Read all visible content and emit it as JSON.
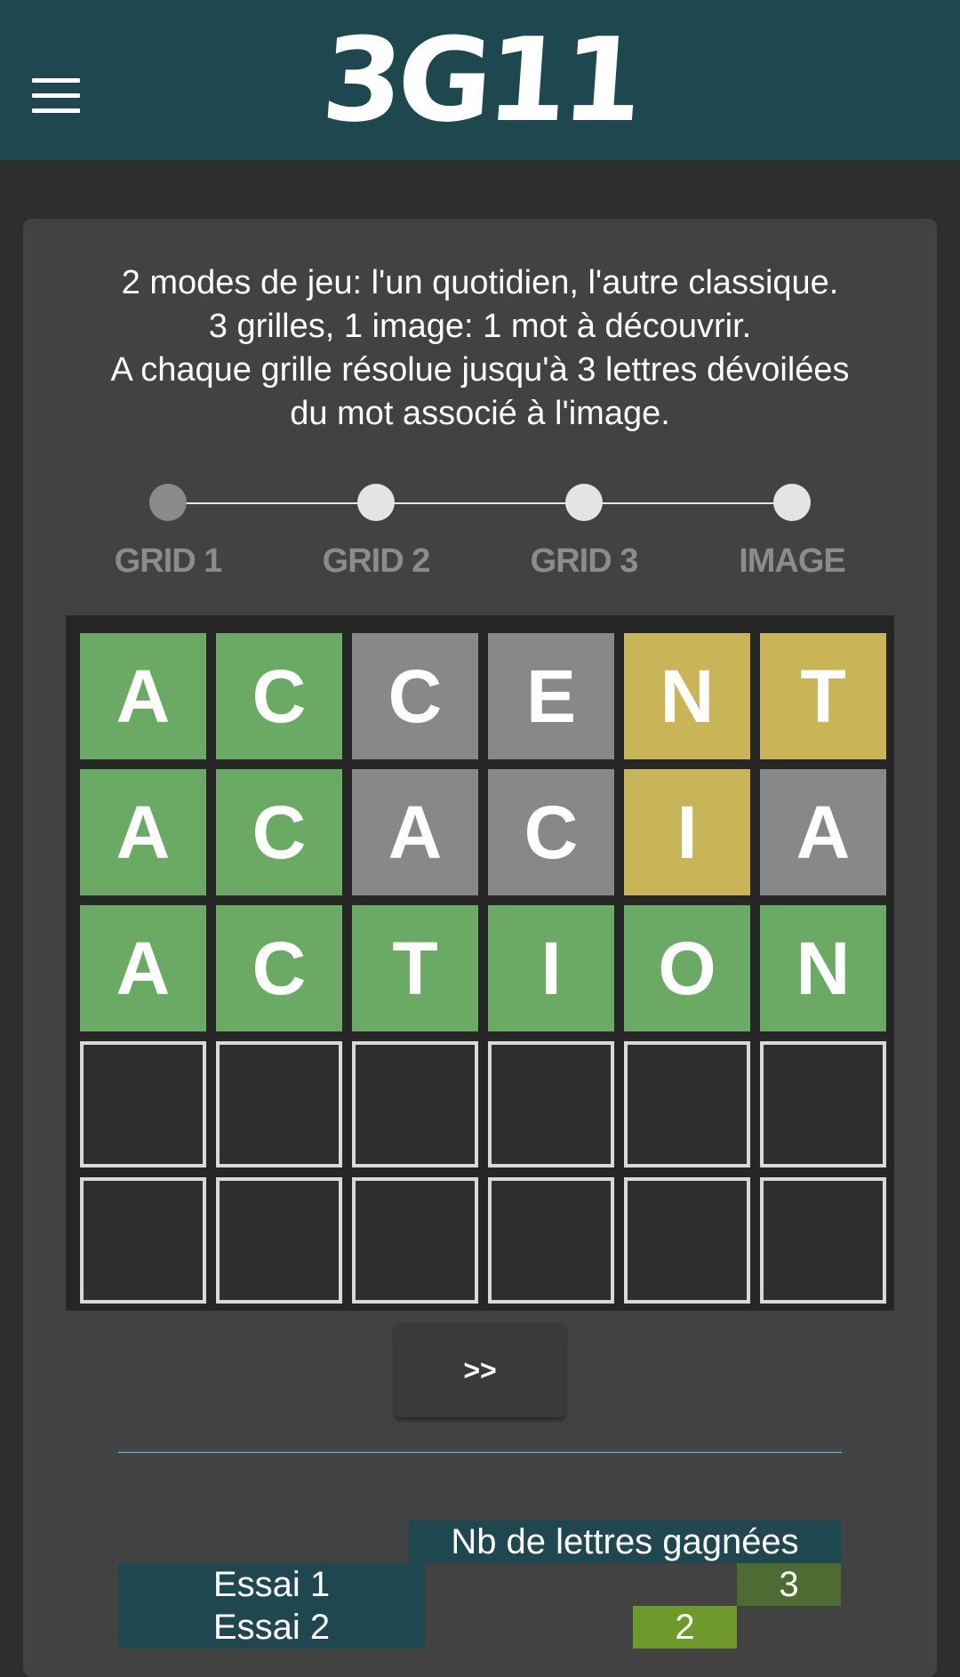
{
  "header": {
    "logo": "3G11",
    "menu_icon": "hamburger-menu-icon",
    "background": "#1f4750"
  },
  "intro": {
    "lines": [
      "2 modes de jeu: l'un quotidien, l'autre classique.",
      "3 grilles, 1 image: 1 mot à découvrir.",
      "A chaque grille résolue jusqu'à 3 lettres dévoilées",
      "du mot associé à l'image."
    ]
  },
  "progress": {
    "current_step": 0,
    "steps": [
      {
        "label": "GRID 1"
      },
      {
        "label": "GRID 2"
      },
      {
        "label": "GRID 3"
      },
      {
        "label": "IMAGE"
      }
    ]
  },
  "board": {
    "colors": {
      "green": "#6aaa64",
      "gray": "#86888a",
      "yellow": "#c9b458",
      "empty_border": "#d9d9d9"
    },
    "rows": [
      [
        {
          "letter": "A",
          "state": "green"
        },
        {
          "letter": "C",
          "state": "green"
        },
        {
          "letter": "C",
          "state": "gray"
        },
        {
          "letter": "E",
          "state": "gray"
        },
        {
          "letter": "N",
          "state": "yellow"
        },
        {
          "letter": "T",
          "state": "yellow"
        }
      ],
      [
        {
          "letter": "A",
          "state": "green"
        },
        {
          "letter": "C",
          "state": "green"
        },
        {
          "letter": "A",
          "state": "gray"
        },
        {
          "letter": "C",
          "state": "gray"
        },
        {
          "letter": "I",
          "state": "yellow"
        },
        {
          "letter": "A",
          "state": "gray"
        }
      ],
      [
        {
          "letter": "A",
          "state": "green"
        },
        {
          "letter": "C",
          "state": "green"
        },
        {
          "letter": "T",
          "state": "green"
        },
        {
          "letter": "I",
          "state": "green"
        },
        {
          "letter": "O",
          "state": "green"
        },
        {
          "letter": "N",
          "state": "green"
        }
      ],
      [
        {
          "letter": "",
          "state": "empty"
        },
        {
          "letter": "",
          "state": "empty"
        },
        {
          "letter": "",
          "state": "empty"
        },
        {
          "letter": "",
          "state": "empty"
        },
        {
          "letter": "",
          "state": "empty"
        },
        {
          "letter": "",
          "state": "empty"
        }
      ],
      [
        {
          "letter": "",
          "state": "empty"
        },
        {
          "letter": "",
          "state": "empty"
        },
        {
          "letter": "",
          "state": "empty"
        },
        {
          "letter": "",
          "state": "empty"
        },
        {
          "letter": "",
          "state": "empty"
        },
        {
          "letter": "",
          "state": "empty"
        }
      ]
    ]
  },
  "next_button": {
    "label": ">>"
  },
  "stats": {
    "header": "Nb de lettres gagnées",
    "max_letters": 3,
    "rows": [
      {
        "label": "Essai 1",
        "value": 3,
        "color": "#4e6b33"
      },
      {
        "label": "Essai 2",
        "value": 2,
        "color": "#6e9a2c"
      }
    ]
  }
}
